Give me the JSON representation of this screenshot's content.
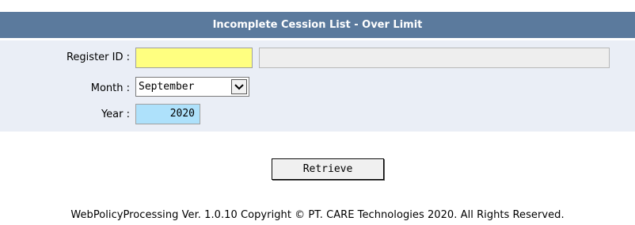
{
  "header": {
    "title": "Incomplete Cession List - Over Limit"
  },
  "form": {
    "register_id": {
      "label": "Register ID :",
      "value": "",
      "name_value": ""
    },
    "month": {
      "label": "Month :",
      "selected": "September"
    },
    "year": {
      "label": "Year :",
      "value": "2020"
    }
  },
  "actions": {
    "retrieve_label": "Retrieve"
  },
  "footer": {
    "text": "WebPolicyProcessing Ver. 1.0.10 Copyright © PT. CARE Technologies 2020. All Rights Reserved."
  },
  "colors": {
    "header_bg": "#5b7a9d",
    "panel_bg": "#eaeef6",
    "register_id_bg": "#ffff80",
    "year_bg": "#aee1fb"
  },
  "icons": {
    "month_dropdown": "chevron-down-icon"
  }
}
